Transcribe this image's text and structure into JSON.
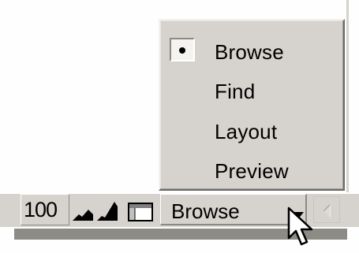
{
  "menu": {
    "items": [
      {
        "label": "Browse",
        "checked": true
      },
      {
        "label": "Find",
        "checked": false
      },
      {
        "label": "Layout",
        "checked": false
      },
      {
        "label": "Preview",
        "checked": false
      }
    ]
  },
  "status_bar": {
    "zoom_level": "100",
    "mode_select_value": "Browse"
  },
  "icons": {
    "zoom_out": "zoom-out-mountain-icon",
    "zoom_in": "zoom-in-mountain-icon",
    "status_toggle": "status-area-toggle-icon",
    "dropdown": "dropdown-arrow-icon",
    "scroll_left": "scroll-left-arrow-icon",
    "cursor": "mouse-pointer-icon"
  },
  "colors": {
    "chrome_face": "#d6d3ce",
    "highlight": "#ffffff",
    "shadow": "#8a8984",
    "text": "#000000"
  }
}
